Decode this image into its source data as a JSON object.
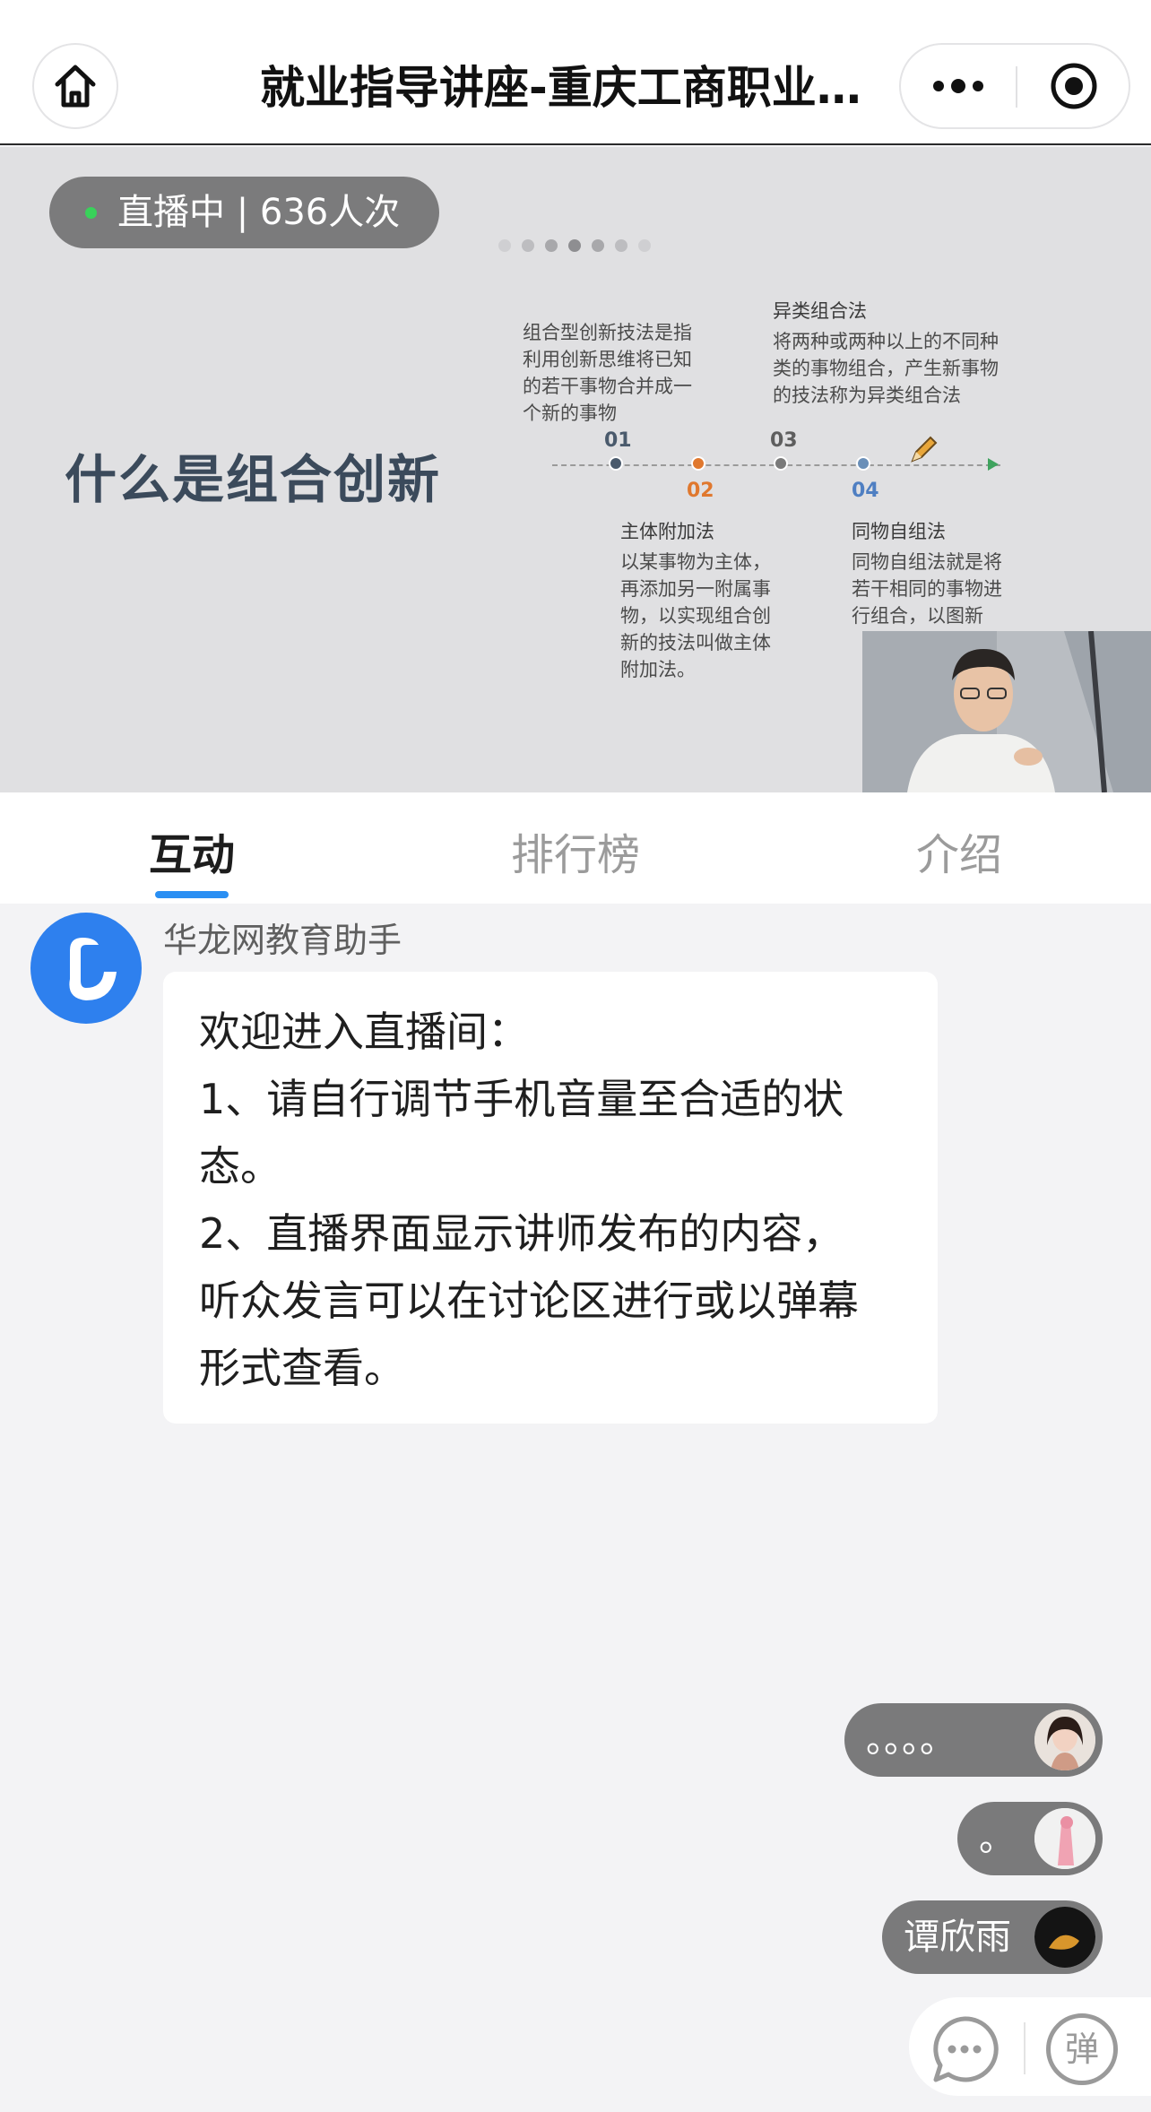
{
  "navbar": {
    "title": "就业指导讲座-重庆工商职业…"
  },
  "live": {
    "status": "直播中 | 636人次"
  },
  "slide": {
    "title": "什么是组合创新",
    "steps": [
      {
        "num": "01",
        "text": "组合型创新技法是指利用创新思维将已知的若干事物合并成一个新的事物"
      },
      {
        "num": "02",
        "head": "主体附加法",
        "text": "以某事物为主体，再添加另一附属事物，以实现组合创新的技法叫做主体附加法。"
      },
      {
        "num": "03",
        "head": "异类组合法",
        "text": "将两种或两种以上的不同种类的事物组合，产生新事物的技法称为异类组合法"
      },
      {
        "num": "04",
        "head": "同物自组法",
        "text": "同物自组法就是将若干相同的事物进行组合，以图新"
      }
    ],
    "colors": {
      "step1": "#4a5a6c",
      "step2": "#e0782e",
      "step3": "#5e5e5e",
      "step4": "#4f7fc2",
      "arrow": "#3fa35e"
    }
  },
  "tabs": [
    {
      "label": "互动",
      "active": true
    },
    {
      "label": "排行榜",
      "active": false
    },
    {
      "label": "介绍",
      "active": false
    }
  ],
  "chat": {
    "sender": "华龙网教育助手",
    "message_lines": [
      "欢迎进入直播间：",
      "1、请自行调节手机音量至合适的状",
      "态。",
      "2、直播界面显示讲师发布的内容，",
      "听众发言可以在讨论区进行或以弹幕",
      "形式查看。"
    ]
  },
  "danmu": [
    {
      "text": "。。。。"
    },
    {
      "text": "。"
    },
    {
      "text": "谭欣雨"
    }
  ],
  "bottom": {
    "danmu_button": "弹"
  },
  "theme": {
    "accent": "#2a8ff3",
    "live_dot": "#39d25a"
  }
}
